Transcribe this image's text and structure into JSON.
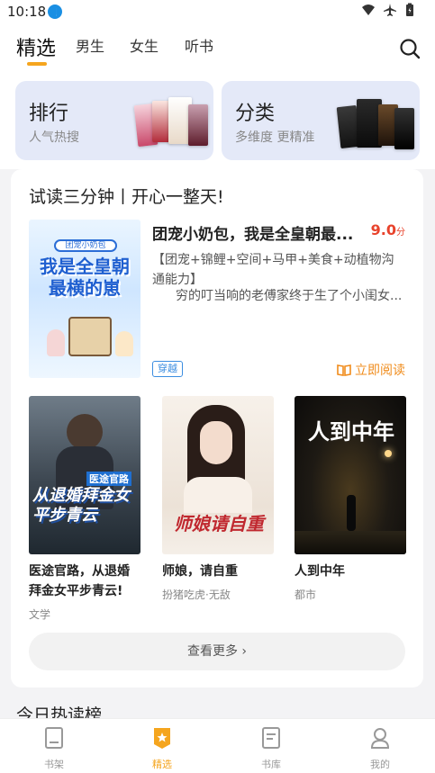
{
  "status": {
    "time": "10:18"
  },
  "header": {
    "tabs": [
      {
        "label": "精选",
        "active": true
      },
      {
        "label": "男生",
        "active": false
      },
      {
        "label": "女生",
        "active": false
      },
      {
        "label": "听书",
        "active": false
      }
    ]
  },
  "top_cards": [
    {
      "title": "排行",
      "subtitle": "人气热搜"
    },
    {
      "title": "分类",
      "subtitle": "多维度 更精准"
    }
  ],
  "panel": {
    "title": "试读三分钟丨开心一整天!",
    "featured": {
      "title": "团宠小奶包，我是全皇朝最...",
      "score": "9.0",
      "score_unit": "分",
      "desc": "【团宠+锦鲤+空间+马甲+美食+动植物沟通能力】",
      "desc2": "穷的叮当响的老傅家终于生了个小闺女...",
      "tag": "穿越",
      "read_label": "立即阅读",
      "cover_text": "我是全皇朝最横的崽",
      "cover_small": "团宠小奶包"
    },
    "books": [
      {
        "title": "医途官路，从退婚拜金女平步青云!",
        "genre": "文学",
        "cover_text": "从退婚拜金女平步青云",
        "cover_top": "医途官路"
      },
      {
        "title": "师娘，请自重",
        "genre": "扮猪吃虎·无敌",
        "cover_text": "师娘请自重"
      },
      {
        "title": "人到中年",
        "genre": "都市",
        "cover_text": "人到中年"
      }
    ],
    "more_label": "查看更多"
  },
  "peek_title": "今日热读榜",
  "bottom_nav": [
    {
      "label": "书架",
      "icon": "bookshelf-icon",
      "active": false
    },
    {
      "label": "精选",
      "icon": "featured-star-icon",
      "active": true
    },
    {
      "label": "书库",
      "icon": "library-icon",
      "active": false
    },
    {
      "label": "我的",
      "icon": "profile-icon",
      "active": false
    }
  ],
  "colors": {
    "accent": "#f5a51e",
    "score": "#e8432c",
    "link": "#3b8de0",
    "card_bg": "#e4e9f8"
  }
}
